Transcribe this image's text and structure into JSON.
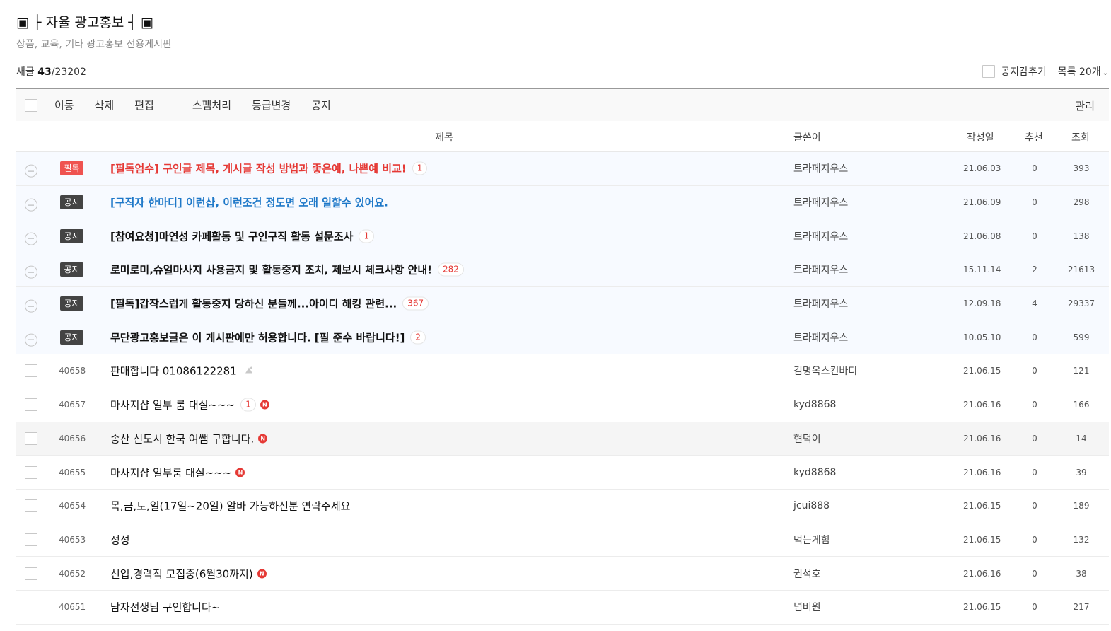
{
  "board": {
    "title": "▣ ├ 자율 광고홍보 ┤ ▣",
    "subtitle": "상품, 교육, 기타 광고홍보 전용게시판",
    "count_prefix": "새글 ",
    "count_new": "43",
    "count_total": "/23202",
    "hide_notice_label": "공지감추기",
    "list_size_label": "목록 20개"
  },
  "toolbar": {
    "move": "이동",
    "delete": "삭제",
    "edit": "편집",
    "spam": "스팸처리",
    "grade": "등급변경",
    "notice": "공지",
    "manage": "관리"
  },
  "columns": {
    "subject": "제목",
    "author": "글쓴이",
    "date": "작성일",
    "likes": "추천",
    "views": "조회"
  },
  "notices": [
    {
      "badge": "필독",
      "subject": "[필독엄수] 구인글 제목, 게시글 작성 방법과 좋은예, 나쁜예 비교!",
      "comments": "1",
      "author": "트라페지우스",
      "date": "21.06.03",
      "likes": "0",
      "views": "393"
    },
    {
      "badge": "공지",
      "subject": "[구직자 한마디] 이런샵, 이런조건 정도면 오래 일할수 있어요.",
      "comments": "",
      "author": "트라페지우스",
      "date": "21.06.09",
      "likes": "0",
      "views": "298"
    },
    {
      "badge": "공지",
      "subject": "[참여요청]마연성 카페활동 및 구인구직 활동 설문조사",
      "comments": "1",
      "author": "트라페지우스",
      "date": "21.06.08",
      "likes": "0",
      "views": "138"
    },
    {
      "badge": "공지",
      "subject": "로미로미,슈얼마사지 사용금지 및 활동중지 조치, 제보시 체크사항 안내!",
      "comments": "282",
      "author": "트라페지우스",
      "date": "15.11.14",
      "likes": "2",
      "views": "21613"
    },
    {
      "badge": "공지",
      "subject": "[필독]갑작스럽게 활동중지 당하신 분들께...아이디 해킹 관련...",
      "comments": "367",
      "author": "트라페지우스",
      "date": "12.09.18",
      "likes": "4",
      "views": "29337"
    },
    {
      "badge": "공지",
      "subject": "무단광고홍보글은 이 게시판에만 허용합니다. [필 준수 바랍니다!]",
      "comments": "2",
      "author": "트라페지우스",
      "date": "10.05.10",
      "likes": "0",
      "views": "599"
    }
  ],
  "posts": [
    {
      "num": "40658",
      "subject": "판매합니다 01086122281",
      "comments": "",
      "author": "김명옥스킨바디",
      "date": "21.06.15",
      "likes": "0",
      "views": "121"
    },
    {
      "num": "40657",
      "subject": "마사지샵 일부 룸 대실~~~",
      "comments": "1",
      "author": "kyd8868",
      "date": "21.06.16",
      "likes": "0",
      "views": "166"
    },
    {
      "num": "40656",
      "subject": "송산 신도시 한국 여쌤 구합니다.",
      "comments": "",
      "author": "현덕이",
      "date": "21.06.16",
      "likes": "0",
      "views": "14"
    },
    {
      "num": "40655",
      "subject": "마사지샵 일부룸 대실~~~",
      "comments": "",
      "author": "kyd8868",
      "date": "21.06.16",
      "likes": "0",
      "views": "39"
    },
    {
      "num": "40654",
      "subject": "목,금,토,일(17일~20일) 알바 가능하신분 연락주세요",
      "comments": "",
      "author": "jcui888",
      "date": "21.06.15",
      "likes": "0",
      "views": "189"
    },
    {
      "num": "40653",
      "subject": "정성",
      "comments": "",
      "author": "먹는게힘",
      "date": "21.06.15",
      "likes": "0",
      "views": "132"
    },
    {
      "num": "40652",
      "subject": "신입,경력직 모집중(6월30까지)",
      "comments": "",
      "author": "권석호",
      "date": "21.06.16",
      "likes": "0",
      "views": "38"
    },
    {
      "num": "40651",
      "subject": "남자선생님 구인합니다~",
      "comments": "",
      "author": "넘버원",
      "date": "21.06.15",
      "likes": "0",
      "views": "217"
    }
  ],
  "icons": {
    "new": "N"
  },
  "colors": {
    "must_badge": "#ef5350",
    "notice_badge": "#444444",
    "red_subject": "#e53935",
    "blue_subject": "#1e78c8"
  }
}
